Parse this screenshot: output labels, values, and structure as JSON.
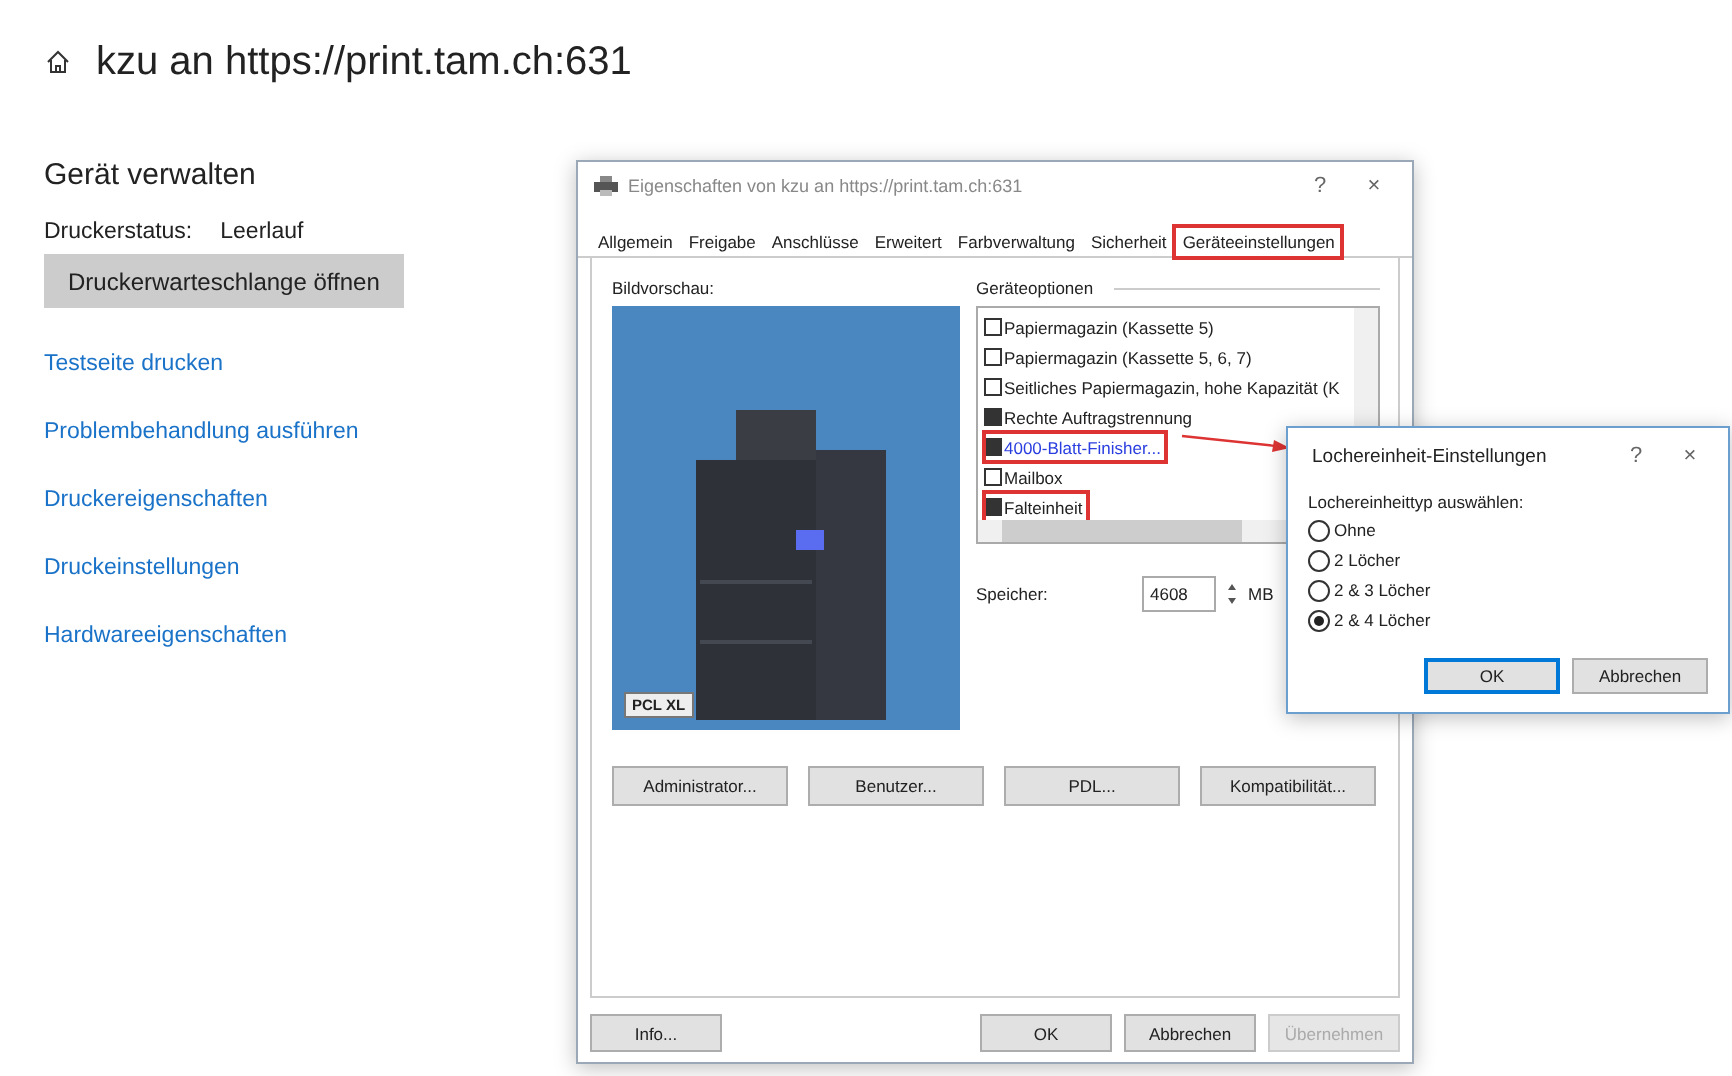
{
  "page": {
    "title": "kzu an https://print.tam.ch:631",
    "section_title": "Gerät verwalten",
    "status_label": "Druckerstatus:",
    "status_value": "Leerlauf",
    "queue_button": "Druckerwarteschlange öffnen",
    "links": [
      "Testseite drucken",
      "Problembehandlung ausführen",
      "Druckereigenschaften",
      "Druckeinstellungen",
      "Hardwareeigenschaften"
    ]
  },
  "properties_dialog": {
    "title": "Eigenschaften von kzu an https://print.tam.ch:631",
    "help": "?",
    "close": "×",
    "tabs": [
      {
        "label": "Allgemein",
        "selected": false,
        "highlighted": false
      },
      {
        "label": "Freigabe",
        "selected": false,
        "highlighted": false
      },
      {
        "label": "Anschlüsse",
        "selected": false,
        "highlighted": false
      },
      {
        "label": "Erweitert",
        "selected": false,
        "highlighted": false
      },
      {
        "label": "Farbverwaltung",
        "selected": false,
        "highlighted": false
      },
      {
        "label": "Sicherheit",
        "selected": false,
        "highlighted": false
      },
      {
        "label": "Geräteeinstellungen",
        "selected": true,
        "highlighted": true
      }
    ],
    "preview_label": "Bildvorschau:",
    "preview_badge": "PCL XL",
    "options_label": "Geräteoptionen",
    "options": [
      {
        "label": "Papiermagazin (Kassette 5)",
        "checked": false,
        "configurable": false,
        "highlighted": false
      },
      {
        "label": "Papiermagazin (Kassette 5, 6, 7)",
        "checked": false,
        "configurable": false,
        "highlighted": false
      },
      {
        "label": "Seitliches Papiermagazin, hohe Kapazität (K",
        "checked": false,
        "configurable": false,
        "highlighted": false
      },
      {
        "label": "Rechte Auftragstrennung",
        "checked": true,
        "configurable": false,
        "highlighted": false
      },
      {
        "label": "4000-Blatt-Finisher...",
        "checked": true,
        "configurable": true,
        "highlighted": true
      },
      {
        "label": "Mailbox",
        "checked": false,
        "configurable": false,
        "highlighted": false
      },
      {
        "label": "Falteinheit",
        "checked": true,
        "configurable": false,
        "highlighted": true
      }
    ],
    "memory_label": "Speicher:",
    "memory_value": "4608",
    "memory_unit": "MB",
    "buttons": [
      "Administrator...",
      "Benutzer...",
      "PDL...",
      "Kompatibilität..."
    ],
    "footer_buttons": [
      {
        "label": "Info...",
        "disabled": false
      },
      {
        "label": "OK",
        "disabled": false
      },
      {
        "label": "Abbrechen",
        "disabled": false
      },
      {
        "label": "Übernehmen",
        "disabled": true
      }
    ]
  },
  "punch_dialog": {
    "title": "Lochereinheit-Einstellungen",
    "help": "?",
    "close": "×",
    "prompt": "Lochereinheittyp auswählen:",
    "options": [
      {
        "label": "Ohne",
        "selected": false
      },
      {
        "label": "2 Löcher",
        "selected": false
      },
      {
        "label": "2 & 3 Löcher",
        "selected": false
      },
      {
        "label": "2 & 4 Löcher",
        "selected": true
      }
    ],
    "buttons": [
      {
        "label": "OK",
        "default": true
      },
      {
        "label": "Abbrechen",
        "default": false
      }
    ]
  }
}
